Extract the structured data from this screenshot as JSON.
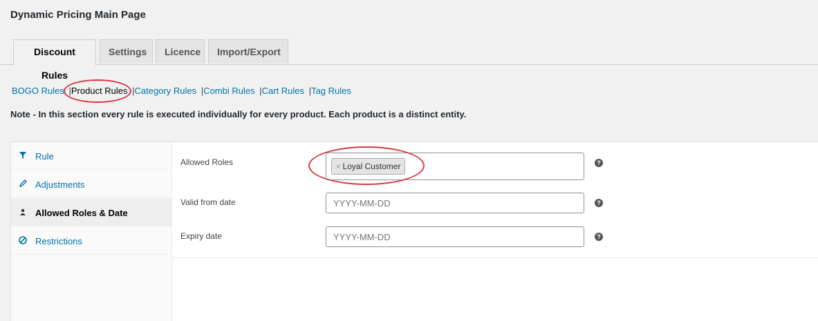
{
  "page": {
    "title": "Dynamic Pricing Main Page"
  },
  "tabs": [
    {
      "label": "Discount Rules",
      "active": true
    },
    {
      "label": "Settings",
      "active": false
    },
    {
      "label": "Licence",
      "active": false
    },
    {
      "label": "Import/Export",
      "active": false
    }
  ],
  "subnav": {
    "items": [
      "BOGO Rules",
      "Product Rules",
      "Category Rules",
      "Combi Rules",
      "Cart Rules",
      "Tag Rules"
    ],
    "separator": "|",
    "current": "Product Rules"
  },
  "note": "Note - In this section every rule is executed individually for every product. Each product is a distinct entity.",
  "sidenav": [
    {
      "label": "Rule",
      "icon": "filter-icon",
      "active": false
    },
    {
      "label": "Adjustments",
      "icon": "pencil-icon",
      "active": false
    },
    {
      "label": "Allowed Roles & Date",
      "icon": "user-icon",
      "active": true
    },
    {
      "label": "Restrictions",
      "icon": "ban-icon",
      "active": false
    }
  ],
  "form": {
    "allowed_roles_label": "Allowed Roles",
    "selected_role": "Loyal Customer",
    "chip_remove": "×",
    "valid_from_label": "Valid from date",
    "valid_from_placeholder": "YYYY-MM-DD",
    "expiry_label": "Expiry date",
    "expiry_placeholder": "YYYY-MM-DD",
    "help_glyph": "?"
  },
  "colors": {
    "link": "#0073aa",
    "annotation": "#d9363e",
    "background": "#f1f1f1"
  }
}
